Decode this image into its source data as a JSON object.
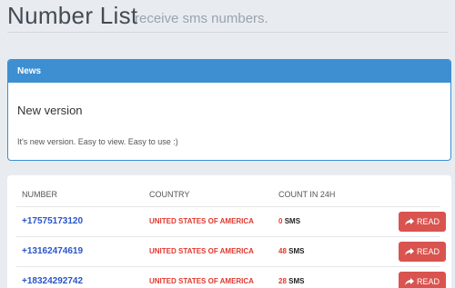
{
  "header": {
    "title": "Number List",
    "subtitle": "receive sms numbers."
  },
  "news": {
    "panel_title": "News",
    "heading": "New version",
    "body": "It's new version. Easy to view. Easy to use :)"
  },
  "table": {
    "columns": [
      "NUMBER",
      "COUNTRY",
      "COUNT IN 24H"
    ],
    "rows": [
      {
        "number": "+17575173120",
        "country": "UNITED STATES OF AMERICA",
        "count": "0",
        "unit": "SMS",
        "action": "READ"
      },
      {
        "number": "+13162474619",
        "country": "UNITED STATES OF AMERICA",
        "count": "48",
        "unit": "SMS",
        "action": "READ"
      },
      {
        "number": "+18324292742",
        "country": "UNITED STATES OF AMERICA",
        "count": "28",
        "unit": "SMS",
        "action": "READ"
      }
    ]
  },
  "colors": {
    "accent": "#3d8fd1",
    "danger": "#d9534f",
    "link": "#2a55c9",
    "country": "#e0392f"
  },
  "icons": {
    "read_button": "share-arrow-icon"
  }
}
